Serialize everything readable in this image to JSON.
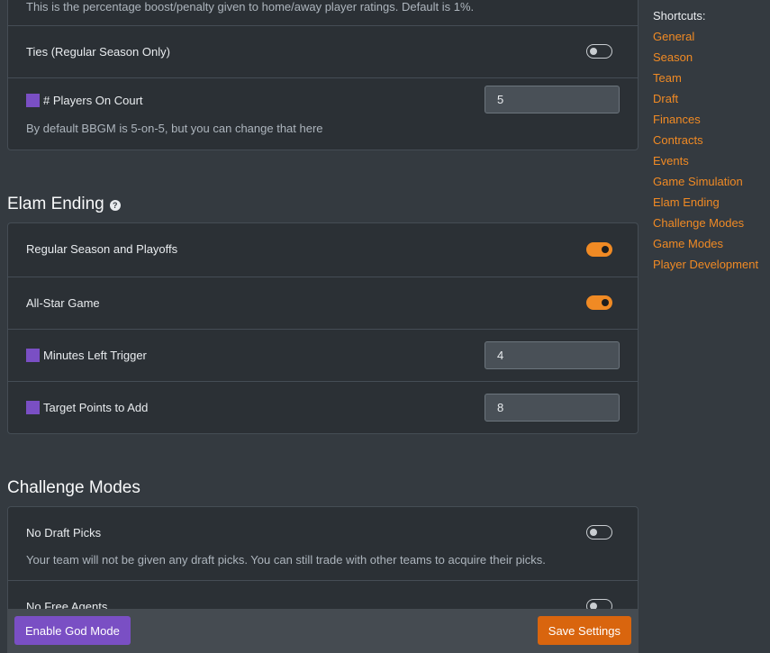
{
  "home_court": {
    "description": "This is the percentage boost/penalty given to home/away player ratings. Default is 1%."
  },
  "ties": {
    "label": "Ties (Regular Season Only)",
    "enabled": false
  },
  "players_on_court": {
    "label": "# Players On Court",
    "value": "5",
    "description": "By default BBGM is 5-on-5, but you can change that here"
  },
  "elam": {
    "heading": "Elam Ending",
    "help_glyph": "?",
    "regular_season": {
      "label": "Regular Season and Playoffs",
      "enabled": true
    },
    "all_star": {
      "label": "All-Star Game",
      "enabled": true
    },
    "minutes_trigger": {
      "label": "Minutes Left Trigger",
      "value": "4"
    },
    "target_points": {
      "label": "Target Points to Add",
      "value": "8"
    }
  },
  "challenge": {
    "heading": "Challenge Modes",
    "no_draft_picks": {
      "label": "No Draft Picks",
      "enabled": false,
      "description": "Your team will not be given any draft picks. You can still trade with other teams to acquire their picks."
    },
    "no_free_agents": {
      "label": "No Free Agents",
      "enabled": false
    }
  },
  "shortcuts": {
    "heading": "Shortcuts:",
    "items": [
      "General",
      "Season",
      "Team",
      "Draft",
      "Finances",
      "Contracts",
      "Events",
      "Game Simulation",
      "Elam Ending",
      "Challenge Modes",
      "Game Modes",
      "Player Development"
    ]
  },
  "footer": {
    "god_mode_label": "Enable God Mode",
    "save_label": "Save Settings"
  },
  "colors": {
    "accent": "#f08a24",
    "god_mode": "#7a4fc4",
    "background": "#343a40"
  }
}
